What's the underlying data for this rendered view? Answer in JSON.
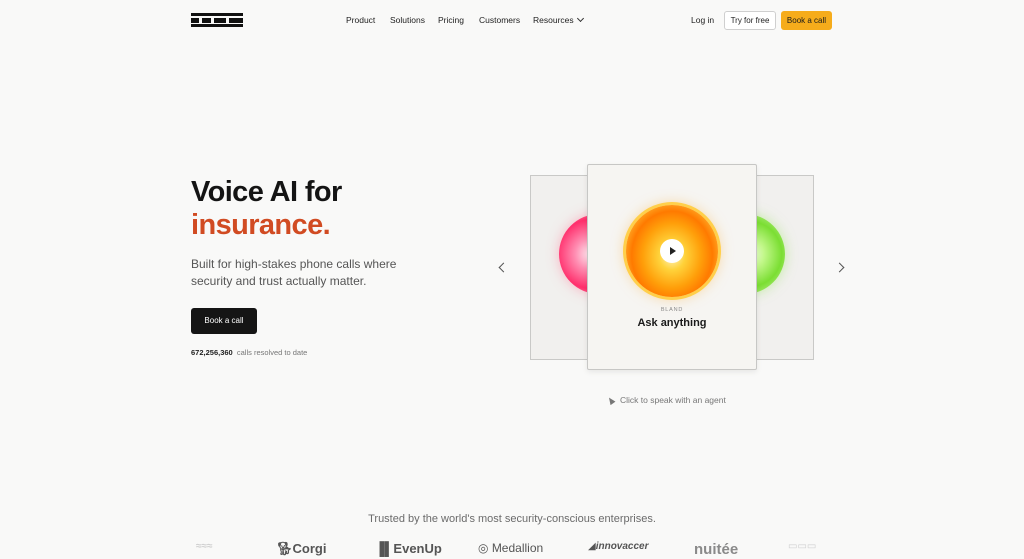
{
  "nav": {
    "brand": "bland",
    "menu": [
      {
        "label": "Product"
      },
      {
        "label": "Solutions"
      },
      {
        "label": "Pricing"
      },
      {
        "label": "Customers"
      },
      {
        "label": "Resources"
      }
    ],
    "login": "Log in",
    "try_free": "Try for free",
    "book_call": "Book a call"
  },
  "hero": {
    "title_line1": "Voice AI for",
    "title_line2": "insurance.",
    "subtitle": "Built for high-stakes phone calls where security and trust actually matter.",
    "cta": "Book a call",
    "calls_count": "672,256,360",
    "calls_suffix": "calls resolved to date"
  },
  "carousel": {
    "brand_label": "BLAND",
    "card_title": "Ask anything",
    "hint": "Click to speak with an agent"
  },
  "trusted": {
    "heading": "Trusted by the world's most security-conscious enterprises.",
    "logos": [
      "Corgi",
      "EvenUp",
      "Medallion",
      "innovaccer",
      "nuitée"
    ]
  },
  "colors": {
    "accent_orange": "#d14b22",
    "cta_yellow": "#f6ac1b",
    "background": "#f9f9f8"
  }
}
